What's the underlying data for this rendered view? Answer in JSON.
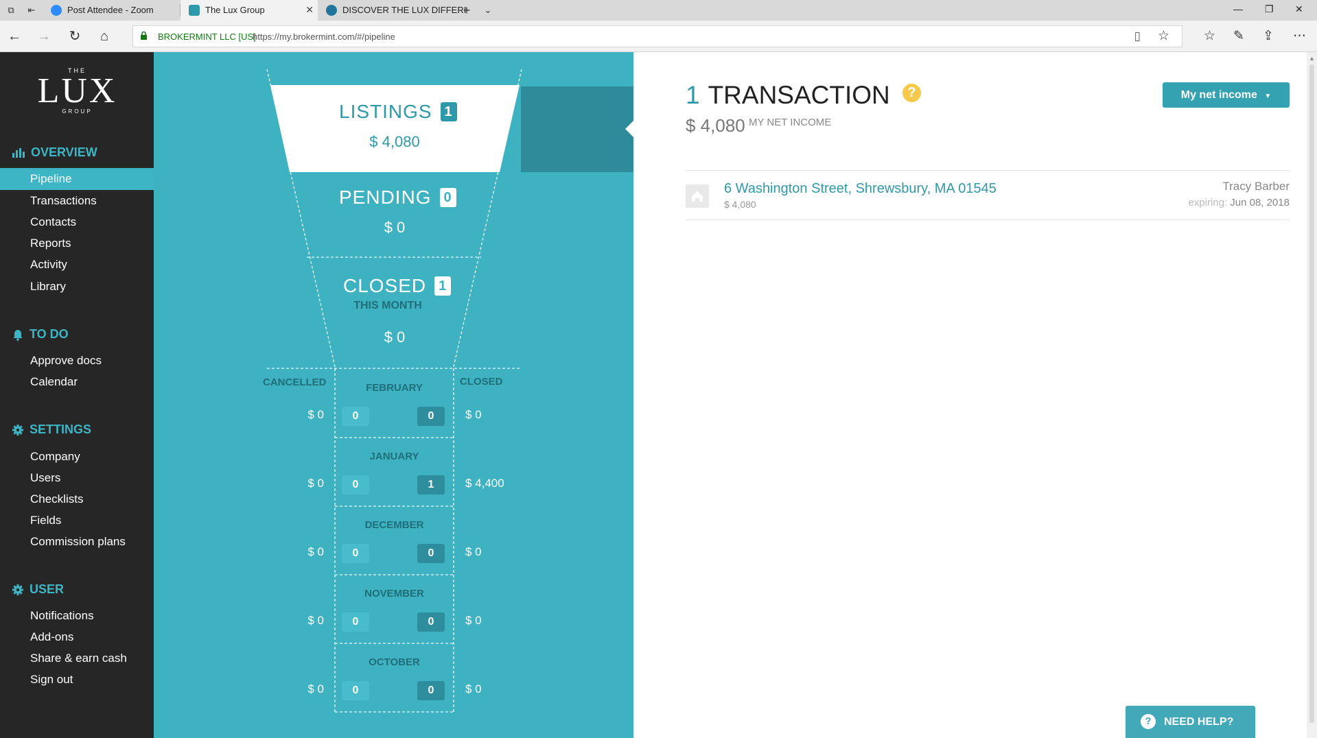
{
  "browser": {
    "tabs": [
      {
        "title": "Post Attendee - Zoom",
        "favicon_color": "#2d8cff"
      },
      {
        "title": "The Lux Group",
        "favicon_color": "#2e99a9"
      },
      {
        "title": "DISCOVER THE LUX DIFFERI",
        "favicon_color": "#21759b"
      }
    ],
    "org": "BROKERMINT LLC [US]",
    "url": "https://my.brokermint.com/#/pipeline"
  },
  "sidebar": {
    "logo": {
      "the": "THE",
      "name": "LUX",
      "group": "GROUP"
    },
    "sections": {
      "overview": {
        "title": "OVERVIEW",
        "items": [
          "Pipeline",
          "Transactions",
          "Contacts",
          "Reports",
          "Activity",
          "Library"
        ]
      },
      "todo": {
        "title": "TO DO",
        "items": [
          "Approve docs",
          "Calendar"
        ]
      },
      "settings": {
        "title": "SETTINGS",
        "items": [
          "Company",
          "Users",
          "Checklists",
          "Fields",
          "Commission plans"
        ]
      },
      "user": {
        "title": "USER",
        "items": [
          "Notifications",
          "Add-ons",
          "Share & earn cash",
          "Sign out"
        ]
      }
    },
    "active_item": "Pipeline"
  },
  "funnel": {
    "listings": {
      "label": "LISTINGS",
      "count": "1",
      "amount": "$ 4,080"
    },
    "pending": {
      "label": "PENDING",
      "count": "0",
      "amount": "$ 0"
    },
    "closed": {
      "label": "CLOSED",
      "count": "1",
      "sublabel": "THIS MONTH",
      "amount": "$ 0"
    },
    "columns": {
      "left": "CANCELLED",
      "right": "CLOSED"
    },
    "months": [
      {
        "name": "FEBRUARY",
        "cancelled": "$ 0",
        "left_count": "0",
        "right_count": "0",
        "closed": "$ 0"
      },
      {
        "name": "JANUARY",
        "cancelled": "$ 0",
        "left_count": "0",
        "right_count": "1",
        "closed": "$ 4,400"
      },
      {
        "name": "DECEMBER",
        "cancelled": "$ 0",
        "left_count": "0",
        "right_count": "0",
        "closed": "$ 0"
      },
      {
        "name": "NOVEMBER",
        "cancelled": "$ 0",
        "left_count": "0",
        "right_count": "0",
        "closed": "$ 0"
      },
      {
        "name": "OCTOBER",
        "cancelled": "$ 0",
        "left_count": "0",
        "right_count": "0",
        "closed": "$ 0"
      }
    ]
  },
  "content": {
    "count": "1",
    "title": "TRANSACTION",
    "net_income": "$ 4,080",
    "net_income_label": "MY NET INCOME",
    "income_button": "My net income",
    "transaction": {
      "address": "6 Washington Street, Shrewsbury, MA 01545",
      "amount": "$ 4,080",
      "agent": "Tracy Barber",
      "expiring_label": "expiring:",
      "expiring_date": "Jun 08, 2018"
    },
    "need_help": "NEED HELP?"
  },
  "colors": {
    "accent": "#3fb2c2",
    "sidebar_bg": "#262626",
    "help_icon": "#f6c94a"
  }
}
